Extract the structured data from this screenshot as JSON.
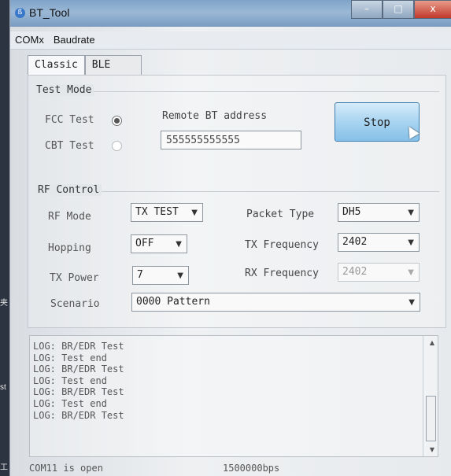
{
  "desktop": {
    "left_labels": [
      "夹",
      "st",
      "工"
    ]
  },
  "window": {
    "title": "BT_Tool",
    "controls": [
      "–",
      "□",
      "x"
    ]
  },
  "menu": [
    "COMx",
    "Baudrate"
  ],
  "tabs": [
    {
      "label": "Classic",
      "active": true
    },
    {
      "label": "BLE",
      "active": false
    }
  ],
  "test_mode": {
    "title": "Test Mode",
    "fcc_label": "FCC Test",
    "cbt_label": "CBT Test",
    "selected": "FCC Test",
    "remote_label": "Remote BT address",
    "remote_value": "555555555555",
    "stop_label": "Stop"
  },
  "rf_control": {
    "title": "RF Control",
    "rf_mode_label": "RF Mode",
    "rf_mode_value": "TX TEST",
    "hopping_label": "Hopping",
    "hopping_value": "OFF",
    "tx_power_label": "TX Power",
    "tx_power_value": "7",
    "packet_type_label": "Packet Type",
    "packet_type_value": "DH5",
    "tx_freq_label": "TX Frequency",
    "tx_freq_value": "2402",
    "rx_freq_label": "RX Frequency",
    "rx_freq_value": "2402",
    "scenario_label": "Scenario",
    "scenario_value": "0000 Pattern"
  },
  "log": [
    "LOG: BR/EDR Test",
    "LOG: Test end",
    "LOG: BR/EDR Test",
    "LOG: Test end",
    "LOG: BR/EDR Test",
    "LOG: Test end",
    "LOG: BR/EDR Test"
  ],
  "status": {
    "port": "COM11 is open",
    "baud": "1500000bps"
  },
  "colors": {
    "stop_button": "#a8d4f1",
    "title_bar": "#9bb8d6"
  }
}
